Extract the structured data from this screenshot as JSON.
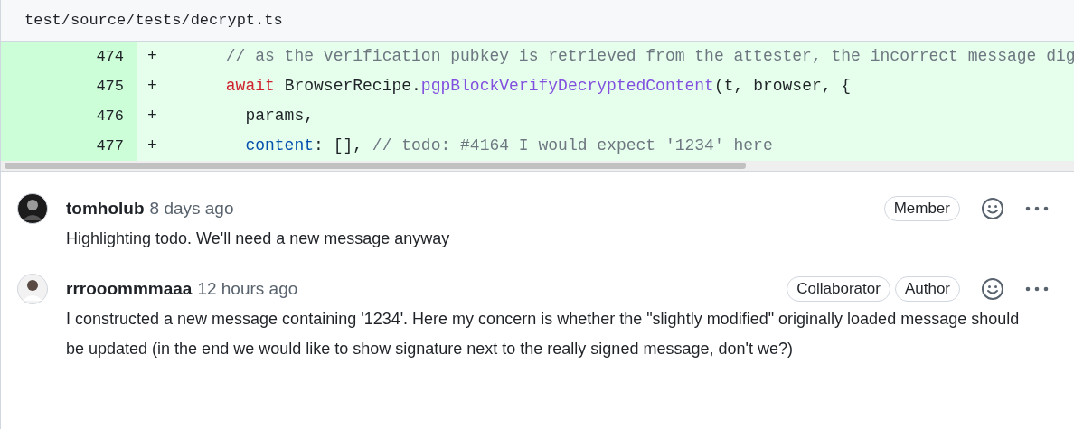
{
  "file": {
    "path": "test/source/tests/decrypt.ts"
  },
  "diff_lines": [
    {
      "number": "474",
      "sign": "+",
      "tokens": [
        {
          "kind": "comment",
          "text": "      // as the verification pubkey is retrieved from the attester, the incorrect message dig"
        }
      ]
    },
    {
      "number": "475",
      "sign": "+",
      "tokens": [
        {
          "kind": "keyword",
          "text": "      await"
        },
        {
          "kind": "plain",
          "text": " BrowserRecipe."
        },
        {
          "kind": "function",
          "text": "pgpBlockVerifyDecryptedContent"
        },
        {
          "kind": "plain",
          "text": "(t, browser, {"
        }
      ]
    },
    {
      "number": "476",
      "sign": "+",
      "tokens": [
        {
          "kind": "plain",
          "text": "        params,"
        }
      ]
    },
    {
      "number": "477",
      "sign": "+",
      "tokens": [
        {
          "kind": "property",
          "text": "        content"
        },
        {
          "kind": "plain",
          "text": ": [], "
        },
        {
          "kind": "comment",
          "text": "// todo: #4164 I would expect '1234' here"
        }
      ]
    }
  ],
  "comments": [
    {
      "author": "tomholub",
      "time": "8 days ago",
      "badges": [
        "Member"
      ],
      "body": "Highlighting todo. We'll need a new message anyway"
    },
    {
      "author": "rrrooommmaaa",
      "time": "12 hours ago",
      "badges": [
        "Collaborator",
        "Author"
      ],
      "body": "I constructed a new message containing '1234'. Here my concern is whether the \"slightly modified\" originally loaded message should be updated (in the end we would like to show signature next to the really signed message, don't we?)"
    }
  ]
}
